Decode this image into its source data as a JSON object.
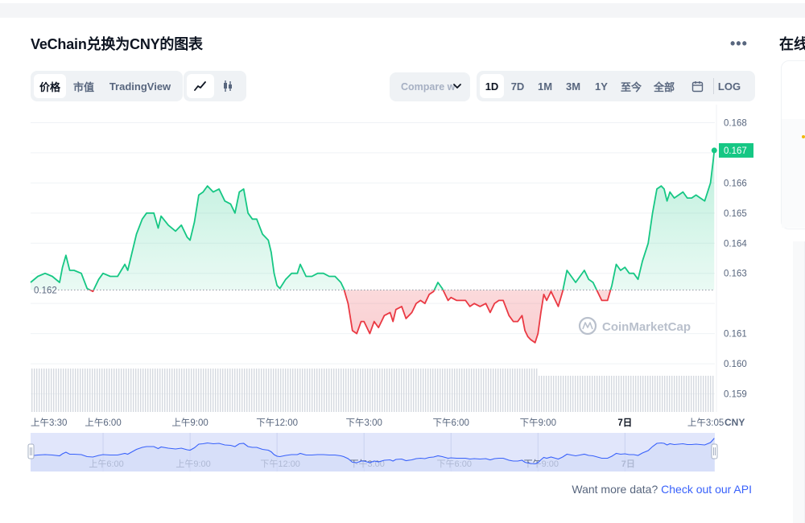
{
  "title": "VeChain兑换为CNY的图表",
  "more_icon": "more-horizontal-icon",
  "right_column_title": "在线",
  "toolbar": {
    "view_tabs": [
      {
        "label": "价格",
        "active": true
      },
      {
        "label": "市值",
        "active": false
      },
      {
        "label": "TradingView",
        "active": false
      }
    ],
    "chart_type_icons": [
      "line-chart-icon",
      "candlestick-icon"
    ],
    "compare_label": "Compare w",
    "ranges": [
      {
        "label": "1D",
        "active": true
      },
      {
        "label": "7D",
        "active": false
      },
      {
        "label": "1M",
        "active": false
      },
      {
        "label": "3M",
        "active": false
      },
      {
        "label": "1Y",
        "active": false
      },
      {
        "label": "至今",
        "active": false
      },
      {
        "label": "全部",
        "active": false
      }
    ],
    "calendar_icon": "calendar-icon",
    "log_label": "LOG"
  },
  "chart_data": {
    "type": "area",
    "currency_label": "CNY",
    "y_ticks": [
      0.159,
      0.16,
      0.161,
      0.162,
      0.163,
      0.164,
      0.165,
      0.166,
      0.167,
      0.168
    ],
    "y_tick_labels": [
      "0.159",
      "0.160",
      "0.161",
      "",
      "0.163",
      "0.164",
      "0.165",
      "0.166",
      "",
      "0.168"
    ],
    "ylim": [
      0.1584,
      0.1686
    ],
    "baseline_value": 0.16245,
    "baseline_label": "0.162",
    "current_value": 0.16708,
    "current_label": "0.167",
    "xlim": [
      3.5,
      27.1
    ],
    "x_ticks": [
      {
        "t": 3.5,
        "label": "上午3:30",
        "bold": false
      },
      {
        "t": 6,
        "label": "上午6:00",
        "bold": false
      },
      {
        "t": 9,
        "label": "上午9:00",
        "bold": false
      },
      {
        "t": 12,
        "label": "下午12:00",
        "bold": false
      },
      {
        "t": 15,
        "label": "下午3:00",
        "bold": false
      },
      {
        "t": 18,
        "label": "下午6:00",
        "bold": false
      },
      {
        "t": 21,
        "label": "下午9:00",
        "bold": false
      },
      {
        "t": 24,
        "label": "7日",
        "bold": true
      },
      {
        "t": 27.08,
        "label": "上午3:05",
        "bold": false
      }
    ],
    "navigator_ticks": [
      {
        "t": 6,
        "label": "上午6:00"
      },
      {
        "t": 9,
        "label": "上午9:00"
      },
      {
        "t": 12,
        "label": "下午12:00"
      },
      {
        "t": 15,
        "label": "下午3:00"
      },
      {
        "t": 18,
        "label": "下午6:00"
      },
      {
        "t": 21,
        "label": "下午9:00"
      },
      {
        "t": 24,
        "label": "7日"
      }
    ],
    "series": [
      {
        "values": [
          [
            3.5,
            0.1627
          ],
          [
            3.75,
            0.1629
          ],
          [
            4.0,
            0.163
          ],
          [
            4.25,
            0.1629
          ],
          [
            4.5,
            0.1627
          ],
          [
            4.6,
            0.1632
          ],
          [
            4.72,
            0.1636
          ],
          [
            4.85,
            0.1631
          ],
          [
            5.0,
            0.1631
          ],
          [
            5.25,
            0.163
          ],
          [
            5.45,
            0.1625
          ],
          [
            5.65,
            0.1624
          ],
          [
            5.85,
            0.1628
          ],
          [
            6.0,
            0.163
          ],
          [
            6.25,
            0.1629
          ],
          [
            6.5,
            0.1629
          ],
          [
            6.75,
            0.1633
          ],
          [
            6.85,
            0.1631
          ],
          [
            7.0,
            0.1637
          ],
          [
            7.15,
            0.1643
          ],
          [
            7.35,
            0.1648
          ],
          [
            7.5,
            0.165
          ],
          [
            7.75,
            0.165
          ],
          [
            7.9,
            0.1645
          ],
          [
            8.0,
            0.1649
          ],
          [
            8.25,
            0.1646
          ],
          [
            8.5,
            0.1644
          ],
          [
            8.7,
            0.1646
          ],
          [
            8.9,
            0.1642
          ],
          [
            9.0,
            0.1641
          ],
          [
            9.15,
            0.1647
          ],
          [
            9.3,
            0.1656
          ],
          [
            9.45,
            0.1657
          ],
          [
            9.6,
            0.1659
          ],
          [
            9.8,
            0.1657
          ],
          [
            10.0,
            0.1658
          ],
          [
            10.2,
            0.1654
          ],
          [
            10.4,
            0.1653
          ],
          [
            10.55,
            0.165
          ],
          [
            10.7,
            0.1657
          ],
          [
            10.85,
            0.1658
          ],
          [
            11.0,
            0.165
          ],
          [
            11.15,
            0.1648
          ],
          [
            11.3,
            0.1648
          ],
          [
            11.5,
            0.1643
          ],
          [
            11.7,
            0.1641
          ],
          [
            11.8,
            0.1637
          ],
          [
            11.9,
            0.163
          ],
          [
            12.0,
            0.1626
          ],
          [
            12.1,
            0.1625
          ],
          [
            12.3,
            0.1628
          ],
          [
            12.5,
            0.163
          ],
          [
            12.7,
            0.163
          ],
          [
            12.8,
            0.1633
          ],
          [
            13.0,
            0.1629
          ],
          [
            13.2,
            0.1629
          ],
          [
            13.4,
            0.163
          ],
          [
            13.6,
            0.163
          ],
          [
            13.8,
            0.1629
          ],
          [
            14.0,
            0.1629
          ],
          [
            14.2,
            0.1627
          ],
          [
            14.3,
            0.1625
          ],
          [
            14.45,
            0.162
          ],
          [
            14.6,
            0.1611
          ],
          [
            14.75,
            0.161
          ],
          [
            14.9,
            0.1614
          ],
          [
            15.0,
            0.1614
          ],
          [
            15.2,
            0.161
          ],
          [
            15.35,
            0.1614
          ],
          [
            15.5,
            0.1612
          ],
          [
            15.7,
            0.1616
          ],
          [
            15.9,
            0.1617
          ],
          [
            16.0,
            0.1614
          ],
          [
            16.1,
            0.1618
          ],
          [
            16.3,
            0.1619
          ],
          [
            16.45,
            0.1615
          ],
          [
            16.65,
            0.1617
          ],
          [
            16.8,
            0.162
          ],
          [
            16.95,
            0.1621
          ],
          [
            17.1,
            0.162
          ],
          [
            17.25,
            0.1623
          ],
          [
            17.4,
            0.1624
          ],
          [
            17.55,
            0.1627
          ],
          [
            17.7,
            0.1625
          ],
          [
            17.9,
            0.1621
          ],
          [
            18.0,
            0.1622
          ],
          [
            18.2,
            0.1621
          ],
          [
            18.35,
            0.1621
          ],
          [
            18.5,
            0.1621
          ],
          [
            18.65,
            0.1619
          ],
          [
            18.8,
            0.162
          ],
          [
            19.0,
            0.1619
          ],
          [
            19.2,
            0.162
          ],
          [
            19.35,
            0.1617
          ],
          [
            19.5,
            0.162
          ],
          [
            19.65,
            0.1621
          ],
          [
            19.8,
            0.1621
          ],
          [
            20.0,
            0.1616
          ],
          [
            20.15,
            0.1614
          ],
          [
            20.3,
            0.1614
          ],
          [
            20.45,
            0.1616
          ],
          [
            20.55,
            0.1611
          ],
          [
            20.65,
            0.1609
          ],
          [
            20.75,
            0.1608
          ],
          [
            20.9,
            0.1607
          ],
          [
            21.0,
            0.161
          ],
          [
            21.1,
            0.1617
          ],
          [
            21.2,
            0.1623
          ],
          [
            21.3,
            0.1621
          ],
          [
            21.45,
            0.1624
          ],
          [
            21.6,
            0.1621
          ],
          [
            21.7,
            0.1619
          ],
          [
            21.85,
            0.1624
          ],
          [
            22.0,
            0.1631
          ],
          [
            22.15,
            0.1629
          ],
          [
            22.3,
            0.1627
          ],
          [
            22.45,
            0.1629
          ],
          [
            22.6,
            0.1631
          ],
          [
            22.75,
            0.1628
          ],
          [
            22.9,
            0.1627
          ],
          [
            23.05,
            0.1624
          ],
          [
            23.2,
            0.1621
          ],
          [
            23.3,
            0.1621
          ],
          [
            23.4,
            0.1621
          ],
          [
            23.55,
            0.1626
          ],
          [
            23.7,
            0.1633
          ],
          [
            23.85,
            0.1631
          ],
          [
            24.0,
            0.1632
          ],
          [
            24.15,
            0.163
          ],
          [
            24.3,
            0.163
          ],
          [
            24.45,
            0.1628
          ],
          [
            24.6,
            0.1634
          ],
          [
            24.8,
            0.164
          ],
          [
            24.95,
            0.165
          ],
          [
            25.1,
            0.1658
          ],
          [
            25.25,
            0.1659
          ],
          [
            25.35,
            0.1658
          ],
          [
            25.45,
            0.1654
          ],
          [
            25.55,
            0.1657
          ],
          [
            25.7,
            0.1655
          ],
          [
            25.85,
            0.1656
          ],
          [
            26.0,
            0.1657
          ],
          [
            26.15,
            0.1655
          ],
          [
            26.3,
            0.1655
          ],
          [
            26.45,
            0.1656
          ],
          [
            26.6,
            0.1655
          ],
          [
            26.75,
            0.1654
          ],
          [
            26.85,
            0.1657
          ],
          [
            26.95,
            0.166
          ],
          [
            27.05,
            0.1668
          ],
          [
            27.08,
            0.16708
          ]
        ]
      }
    ],
    "watermark": "CoinMarketCap",
    "grid": true,
    "colors": {
      "up": "#16c784",
      "down": "#ea3943",
      "grid": "#eff2f5",
      "axis_text": "#58667e",
      "navigator_line": "#3861fb",
      "navigator_fill": "#e1e6fb"
    }
  },
  "footer": {
    "text": "Want more data?",
    "link": "Check out our API"
  }
}
